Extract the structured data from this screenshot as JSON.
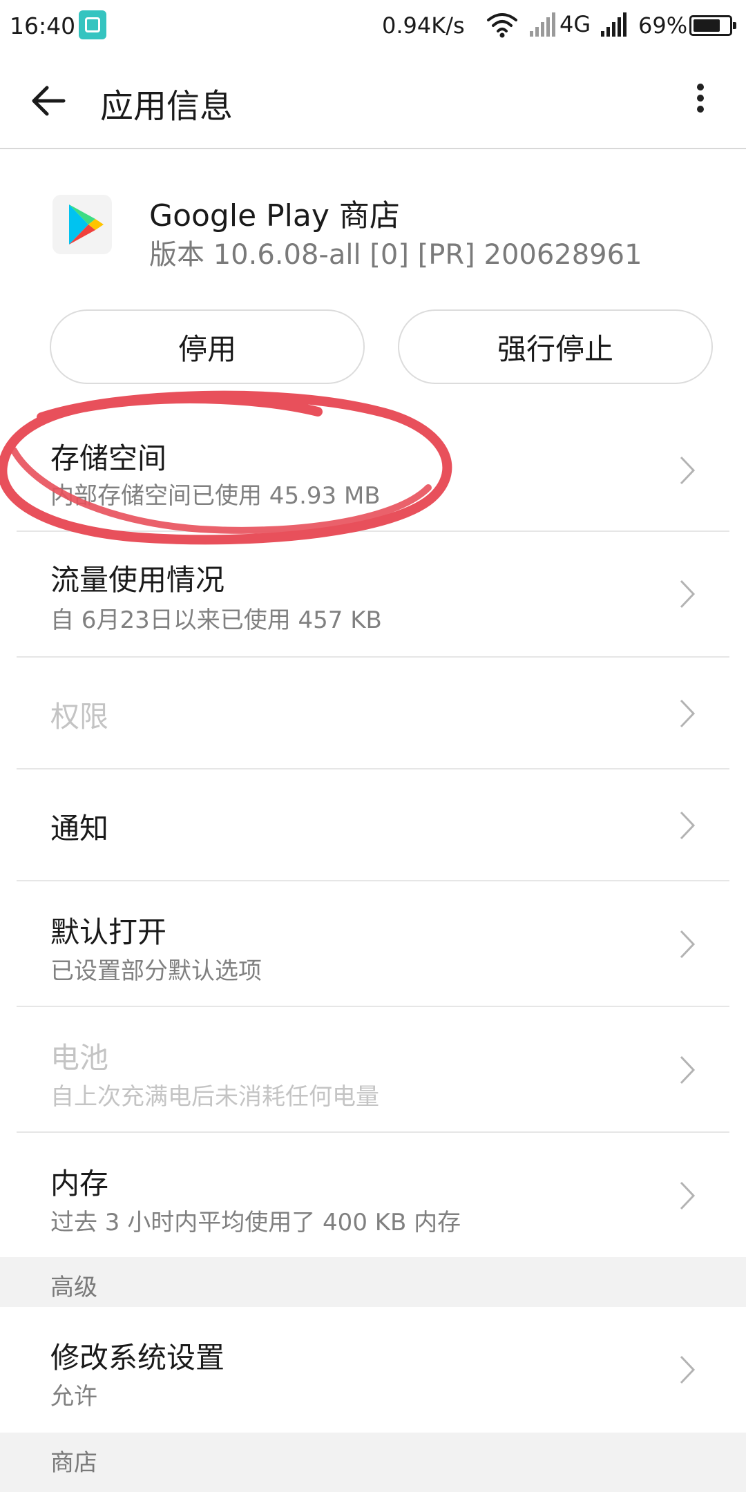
{
  "status_bar": {
    "time": "16:40",
    "speed": "0.94K/s",
    "network": "4G",
    "battery": "69%",
    "app_icon": "screen-capture-icon"
  },
  "header": {
    "title": "应用信息",
    "back_icon": "arrow-left-icon",
    "more_icon": "more-vertical-icon"
  },
  "app": {
    "name": "Google Play 商店",
    "version": "版本 10.6.08-all [0] [PR] 200628961",
    "icon": "google-play-icon"
  },
  "buttons": {
    "disable": "停用",
    "force_stop": "强行停止"
  },
  "rows": [
    {
      "title": "存储空间",
      "subtitle": "内部存储空间已使用 45.93 MB"
    },
    {
      "title": "流量使用情况",
      "subtitle": "自 6月23日以来已使用 457 KB"
    },
    {
      "title": "权限",
      "subtitle": ""
    },
    {
      "title": "通知",
      "subtitle": ""
    },
    {
      "title": "默认打开",
      "subtitle": "已设置部分默认选项"
    },
    {
      "title": "电池",
      "subtitle": "自上次充满电后未消耗任何电量"
    },
    {
      "title": "内存",
      "subtitle": "过去 3 小时内平均使用了 400 KB 内存"
    }
  ],
  "sections": {
    "advanced": "高级",
    "store": "商店"
  },
  "advanced_rows": [
    {
      "title": "修改系统设置",
      "subtitle": "允许"
    }
  ],
  "colors": {
    "annotation": "#e8505b",
    "disabled_text": "#c4c4c4",
    "section_bg": "#f2f2f2"
  }
}
